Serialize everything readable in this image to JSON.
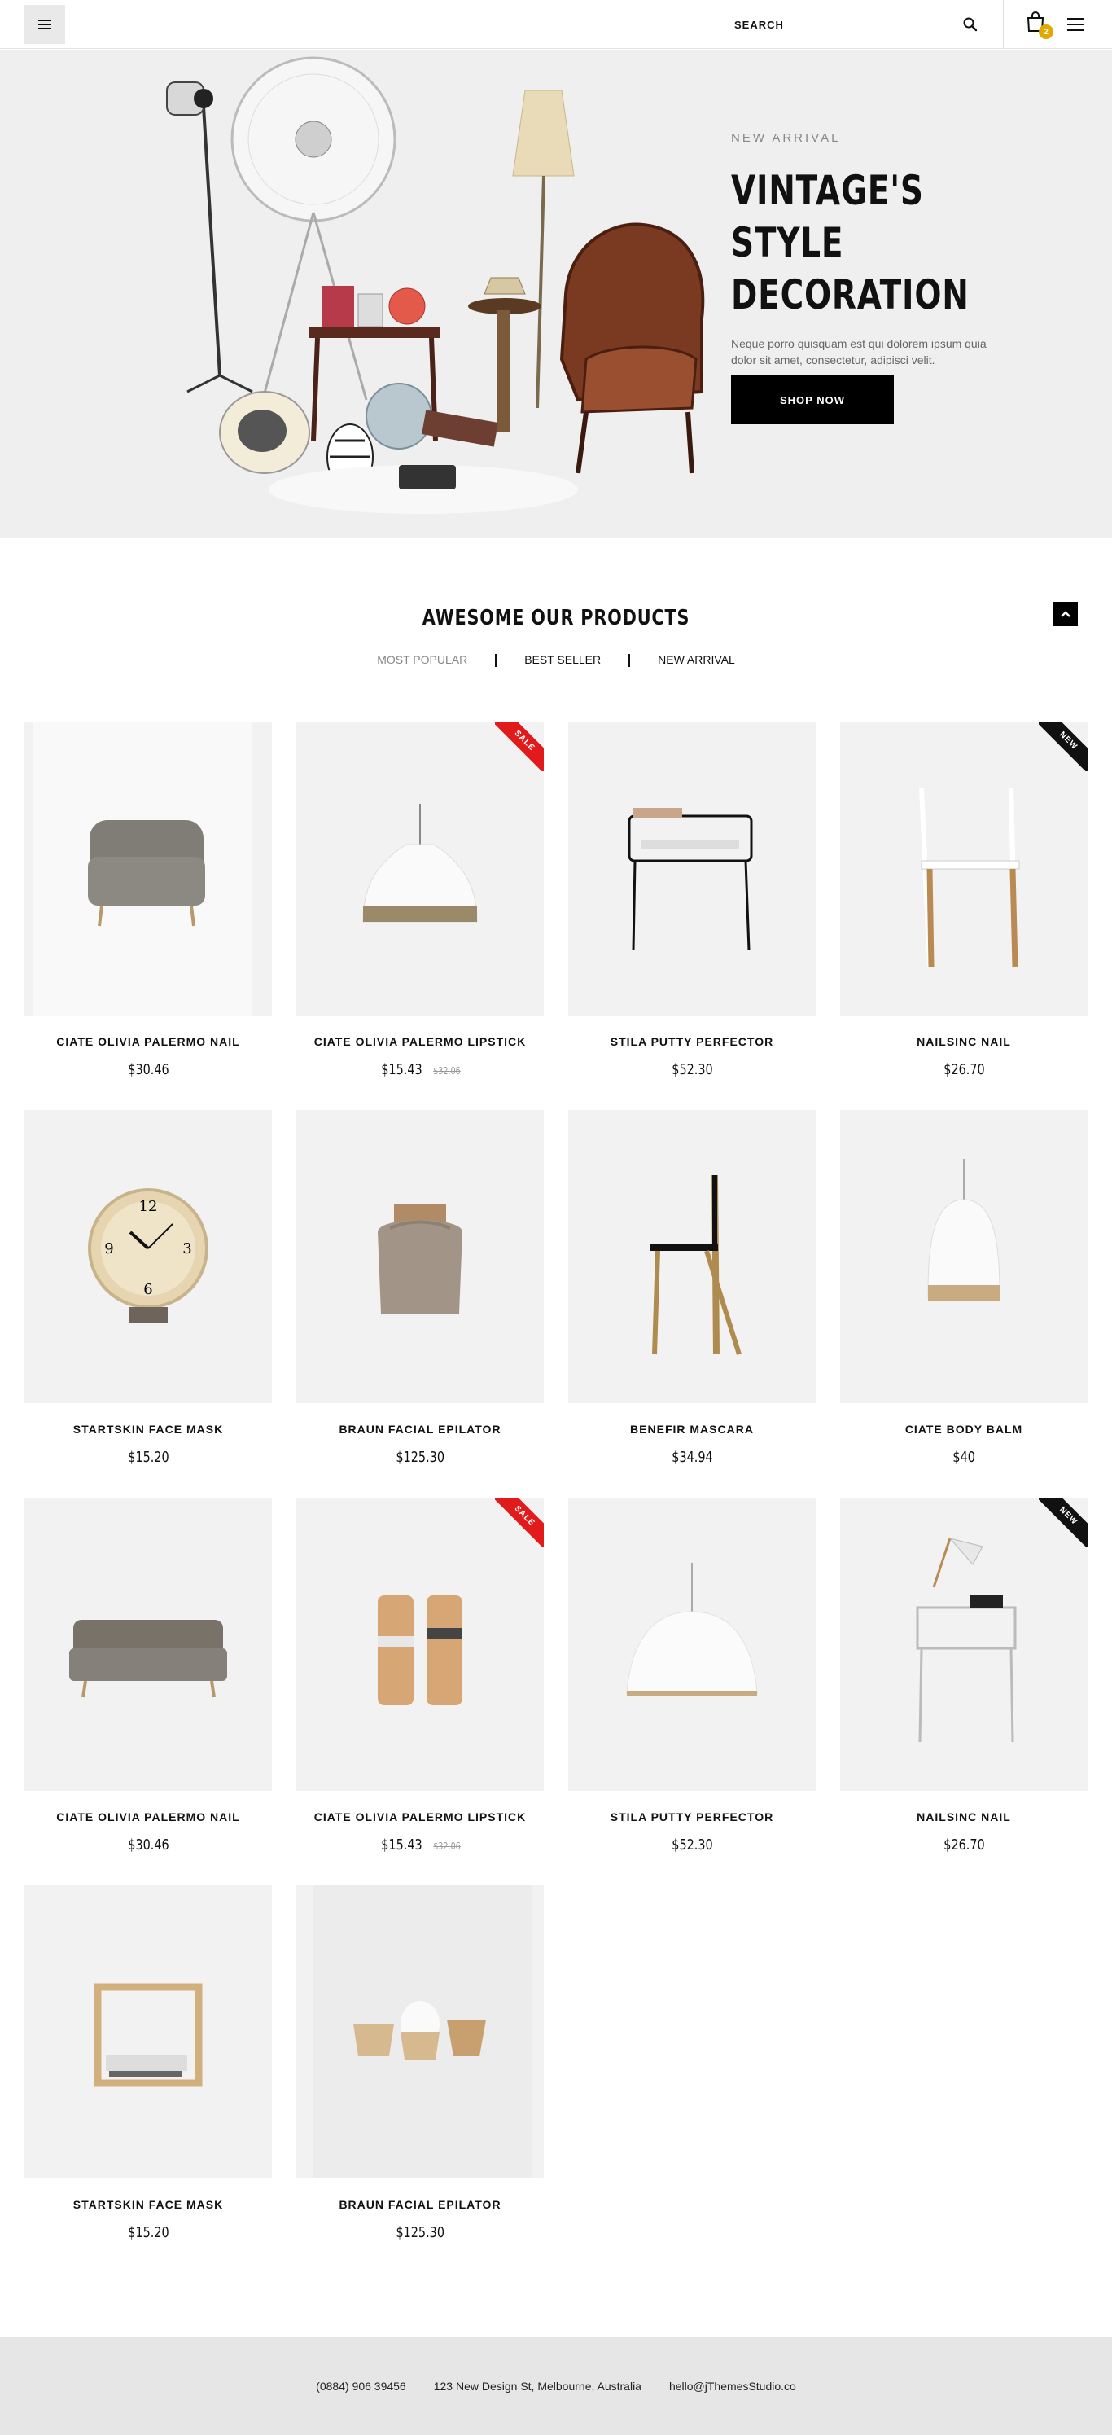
{
  "header": {
    "search_placeholder": "SEARCH",
    "cart_count": "2"
  },
  "hero": {
    "kicker": "NEW ARRIVAL",
    "title_line1": "VINTAGE'S STYLE",
    "title_line2": "DECORATION",
    "description": "Neque porro quisquam est qui dolorem ipsum quia dolor sit amet, consectetur, adipisci velit.",
    "button_label": "SHOP NOW"
  },
  "products_section": {
    "title": "AWESOME OUR PRODUCTS",
    "tabs": [
      "MOST POPULAR",
      "BEST SELLER",
      "NEW ARRIVAL"
    ]
  },
  "products": [
    {
      "name": "CIATE OLIVIA PALERMO NAIL",
      "price": "$30.46",
      "old_price": "",
      "badge": "",
      "image": "armchair"
    },
    {
      "name": "CIATE OLIVIA PALERMO LIPSTICK",
      "price": "$15.43",
      "old_price": "$32.06",
      "badge": "SALE",
      "image": "pendant-lamp"
    },
    {
      "name": "STILA PUTTY PERFECTOR",
      "price": "$52.30",
      "old_price": "",
      "badge": "",
      "image": "side-table"
    },
    {
      "name": "NAILSINC NAIL",
      "price": "$26.70",
      "old_price": "",
      "badge": "NEW",
      "image": "chair"
    },
    {
      "name": "STARTSKIN FACE MASK",
      "price": "$15.20",
      "old_price": "",
      "badge": "",
      "image": "clock"
    },
    {
      "name": "BRAUN FACIAL EPILATOR",
      "price": "$125.30",
      "old_price": "",
      "badge": "",
      "image": "vase"
    },
    {
      "name": "BENEFIR MASCARA",
      "price": "$34.94",
      "old_price": "",
      "badge": "",
      "image": "wood-chair"
    },
    {
      "name": "CIATE BODY BALM",
      "price": "$40",
      "old_price": "",
      "badge": "",
      "image": "dome-lamp"
    },
    {
      "name": "CIATE OLIVIA PALERMO NAIL",
      "price": "$30.46",
      "old_price": "",
      "badge": "",
      "image": "sofa"
    },
    {
      "name": "CIATE OLIVIA PALERMO LIPSTICK",
      "price": "$15.43",
      "old_price": "$32.06",
      "badge": "SALE",
      "image": "grinders"
    },
    {
      "name": "STILA PUTTY PERFECTOR",
      "price": "$52.30",
      "old_price": "",
      "badge": "",
      "image": "white-lamp"
    },
    {
      "name": "NAILSINC NAIL",
      "price": "$26.70",
      "old_price": "",
      "badge": "NEW",
      "image": "desk-lamp-table"
    },
    {
      "name": "STARTSKIN FACE MASK",
      "price": "$15.20",
      "old_price": "",
      "badge": "",
      "image": "wood-box"
    },
    {
      "name": "BRAUN FACIAL EPILATOR",
      "price": "$125.30",
      "old_price": "",
      "badge": "",
      "image": "bowls"
    }
  ],
  "footer": {
    "phone": "(0884) 906 39456",
    "address": "123 New Design St, Melbourne, Australia",
    "email": "hello@jThemesStudio.co"
  }
}
